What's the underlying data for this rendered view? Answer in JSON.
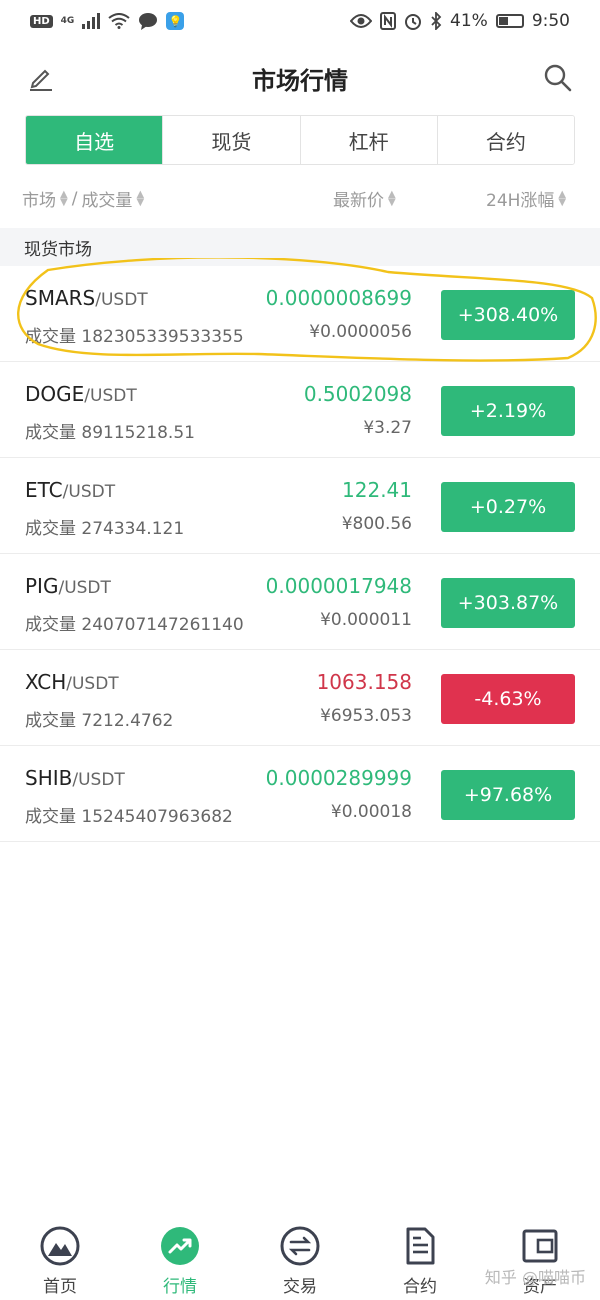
{
  "status_bar": {
    "hd": "HD",
    "network": "4G",
    "app_badge": "💡",
    "battery_text": "41%",
    "battery_level": 0.41,
    "time": "9:50",
    "icons": [
      "eye-icon",
      "nfc-icon",
      "alarm-icon",
      "bluetooth-icon"
    ]
  },
  "header": {
    "title": "市场行情",
    "left_icon": "edit-icon",
    "right_icon": "search-icon"
  },
  "tabs": [
    {
      "label": "自选",
      "active": true
    },
    {
      "label": "现货",
      "active": false
    },
    {
      "label": "杠杆",
      "active": false
    },
    {
      "label": "合约",
      "active": false
    }
  ],
  "sort_bar": {
    "market": "市场",
    "separator": "/",
    "volume": "成交量",
    "latest_price": "最新价",
    "change_24h": "24H涨幅"
  },
  "section": {
    "title": "现货市场"
  },
  "volume_prefix": "成交量",
  "rows": [
    {
      "base": "SMARS",
      "quote": "/USDT",
      "volume": "182305339533355",
      "price": "0.0000008699",
      "fiat": "¥0.0000056",
      "change": "+308.40%",
      "direction": "up"
    },
    {
      "base": "DOGE",
      "quote": "/USDT",
      "volume": "89115218.51",
      "price": "0.5002098",
      "fiat": "¥3.27",
      "change": "+2.19%",
      "direction": "up"
    },
    {
      "base": "ETC",
      "quote": "/USDT",
      "volume": "274334.121",
      "price": "122.41",
      "fiat": "¥800.56",
      "change": "+0.27%",
      "direction": "up"
    },
    {
      "base": "PIG",
      "quote": "/USDT",
      "volume": "240707147261140",
      "price": "0.0000017948",
      "fiat": "¥0.000011",
      "change": "+303.87%",
      "direction": "up"
    },
    {
      "base": "XCH",
      "quote": "/USDT",
      "volume": "7212.4762",
      "price": "1063.158",
      "fiat": "¥6953.053",
      "change": "-4.63%",
      "direction": "down"
    },
    {
      "base": "SHIB",
      "quote": "/USDT",
      "volume": "15245407963682",
      "price": "0.0000289999",
      "fiat": "¥0.00018",
      "change": "+97.68%",
      "direction": "up"
    }
  ],
  "bottom_nav": [
    {
      "label": "首页",
      "icon": "mountain-icon",
      "active": false
    },
    {
      "label": "行情",
      "icon": "trend-icon",
      "active": true
    },
    {
      "label": "交易",
      "icon": "exchange-icon",
      "active": false
    },
    {
      "label": "合约",
      "icon": "document-icon",
      "active": false
    },
    {
      "label": "资产",
      "icon": "wallet-icon",
      "active": false
    }
  ],
  "watermark": "知乎 @喵喵币",
  "colors": {
    "accent": "#2fb97a",
    "down": "#e0324f",
    "highlight": "#f2c21a"
  }
}
